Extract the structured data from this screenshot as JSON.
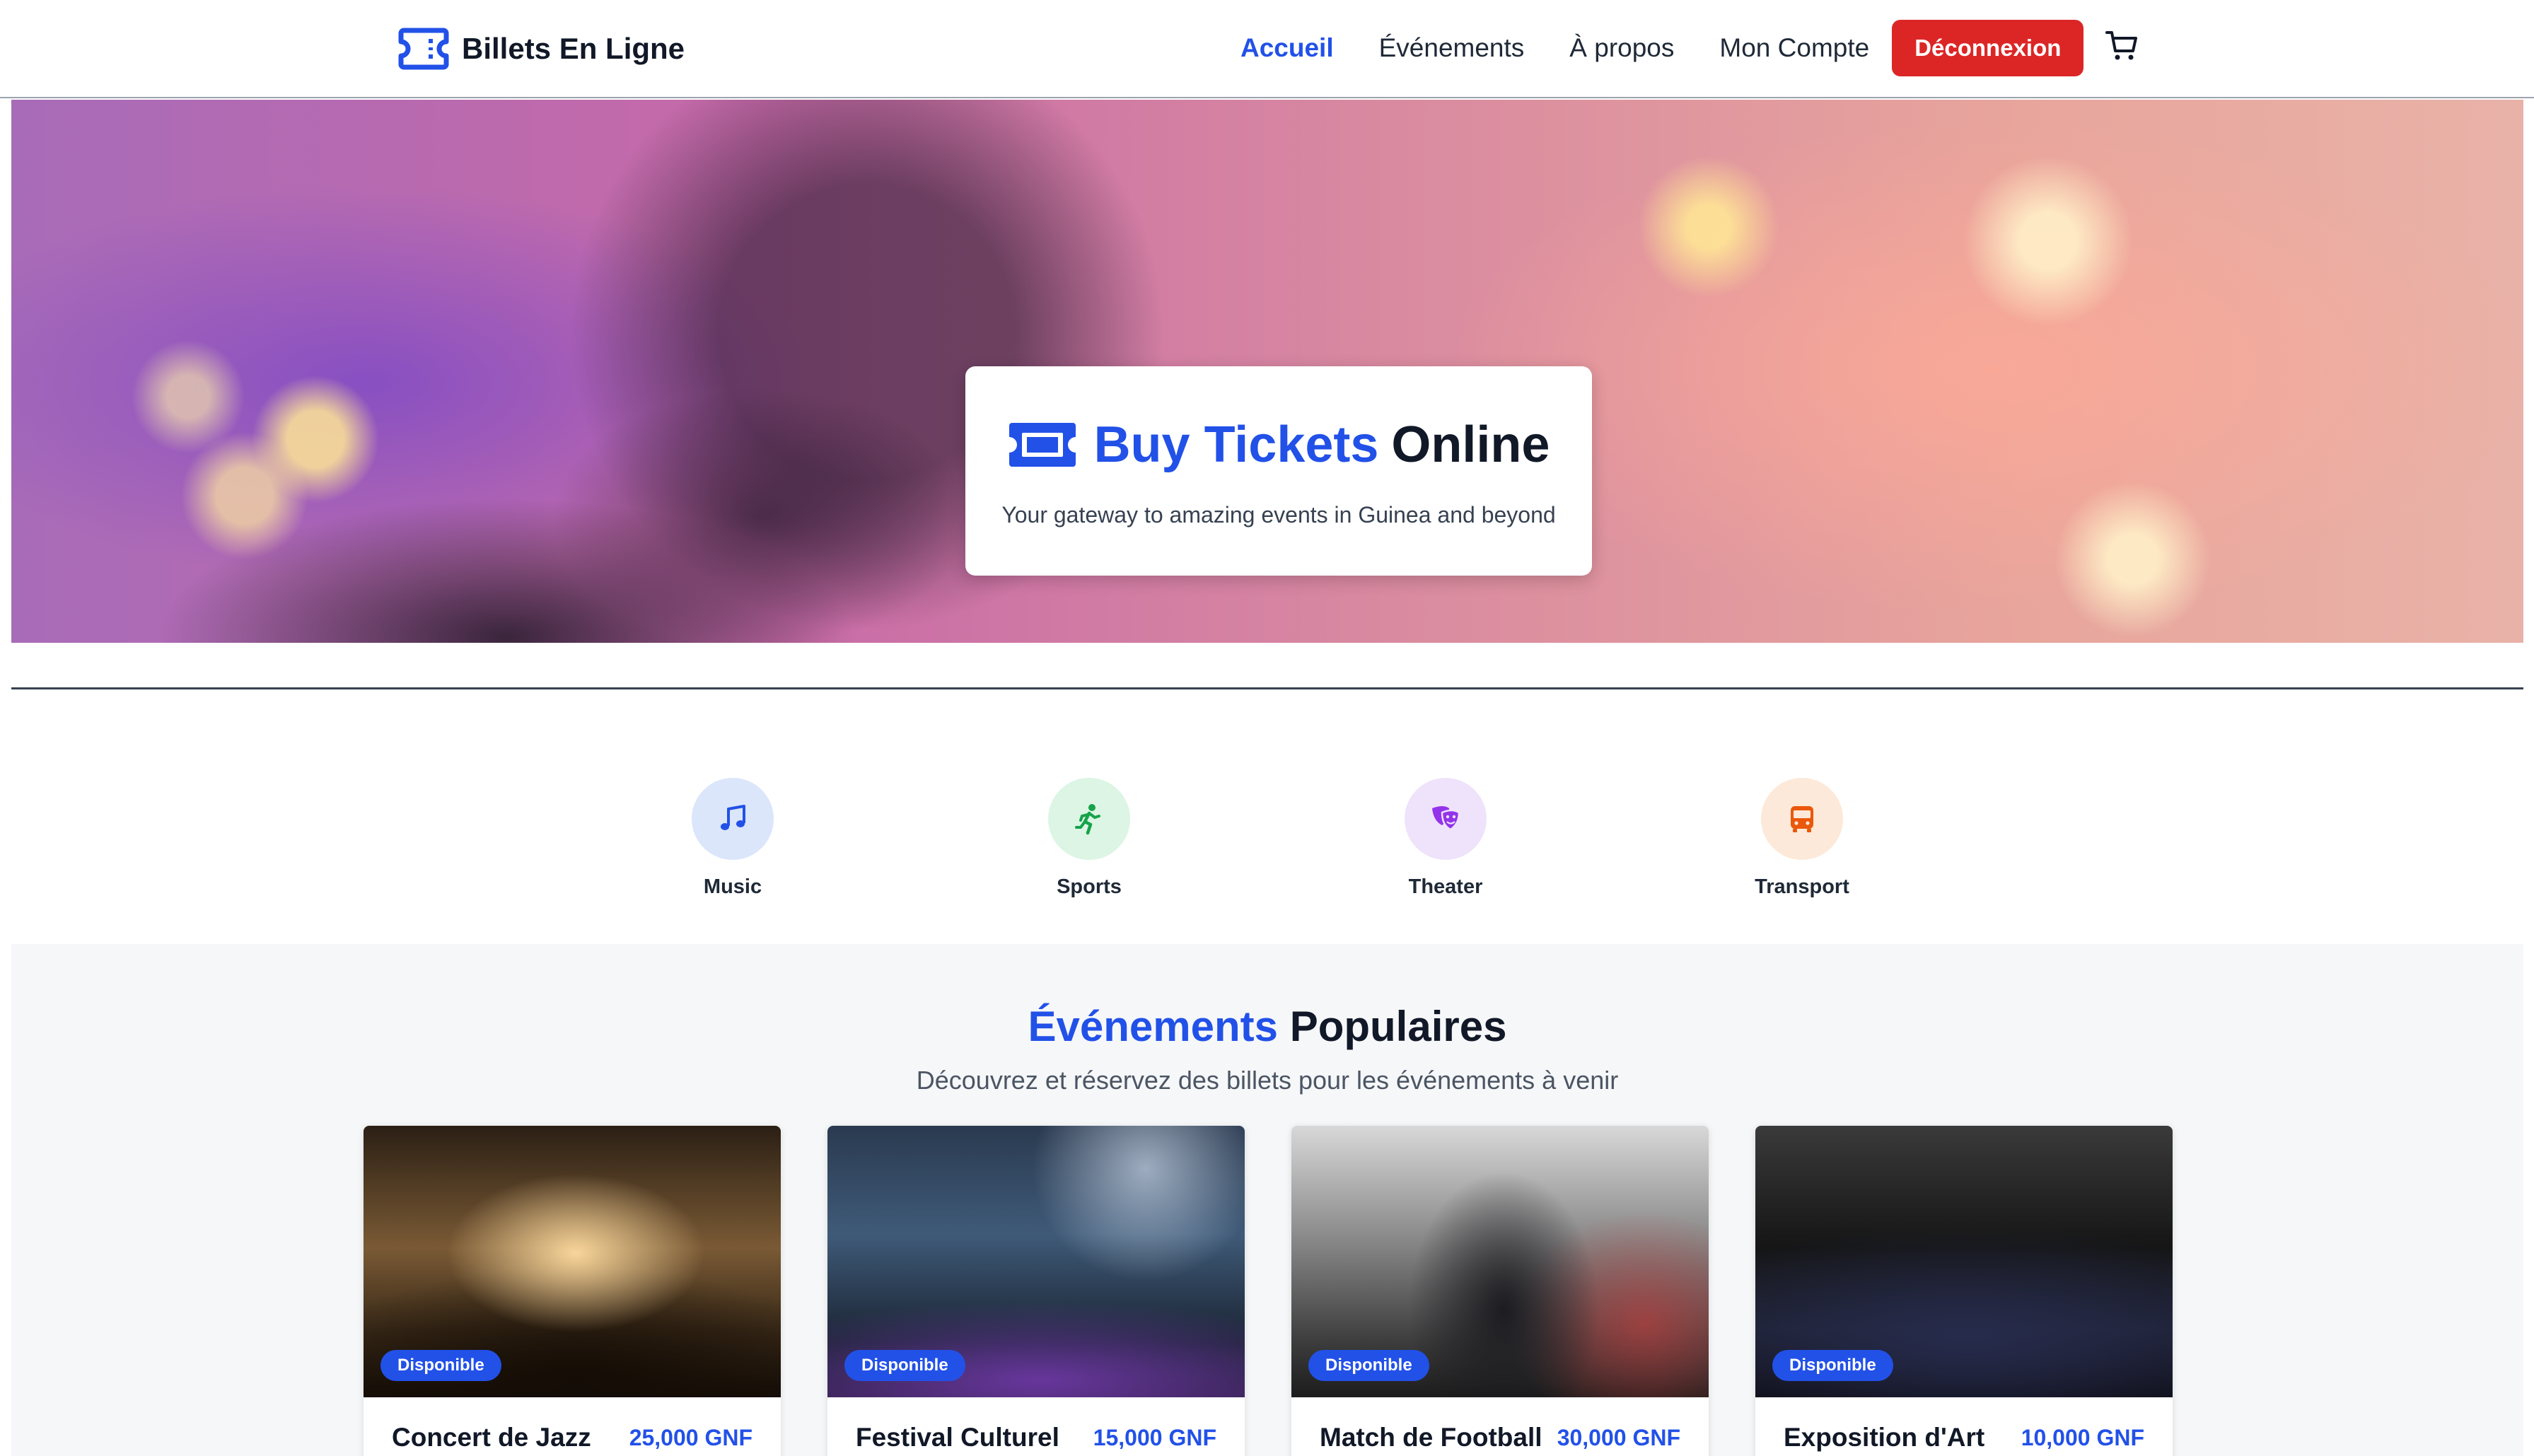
{
  "navbar": {
    "brand": "Billets En Ligne",
    "links": [
      "Accueil",
      "Événements",
      "À propos",
      "Mon Compte"
    ],
    "active_link": "Accueil",
    "logout_label": "Déconnexion",
    "brand_icon": "ticket-icon",
    "cart_icon": "cart-icon"
  },
  "hero": {
    "title_highlight": "Buy Tickets",
    "title_rest": "Online",
    "subtitle": "Your gateway to amazing events in Guinea and beyond",
    "icon": "ticket-icon"
  },
  "categories": [
    {
      "label": "Music",
      "icon": "music-note-icon",
      "color": "#2251e8",
      "bg": "#dbe6fb"
    },
    {
      "label": "Sports",
      "icon": "running-person-icon",
      "color": "#16a34a",
      "bg": "#dcf5e4"
    },
    {
      "label": "Theater",
      "icon": "theater-masks-icon",
      "color": "#9333ea",
      "bg": "#efe3fb"
    },
    {
      "label": "Transport",
      "icon": "bus-icon",
      "color": "#ea580c",
      "bg": "#fde9d9"
    }
  ],
  "popular": {
    "title_highlight": "Événements",
    "title_rest": "Populaires",
    "subtitle": "Découvrez et réservez des billets pour les événements à venir",
    "events": [
      {
        "title": "Concert de Jazz",
        "price": "25,000 GNF",
        "status": "Disponible"
      },
      {
        "title": "Festival Culturel",
        "price": "15,000 GNF",
        "status": "Disponible"
      },
      {
        "title": "Match de Football",
        "price": "30,000 GNF",
        "status": "Disponible"
      },
      {
        "title": "Exposition d'Art",
        "price": "10,000 GNF",
        "status": "Disponible"
      }
    ]
  },
  "colors": {
    "accent": "#2251e8",
    "danger": "#dc2626",
    "section_bg": "#f6f7f9"
  }
}
